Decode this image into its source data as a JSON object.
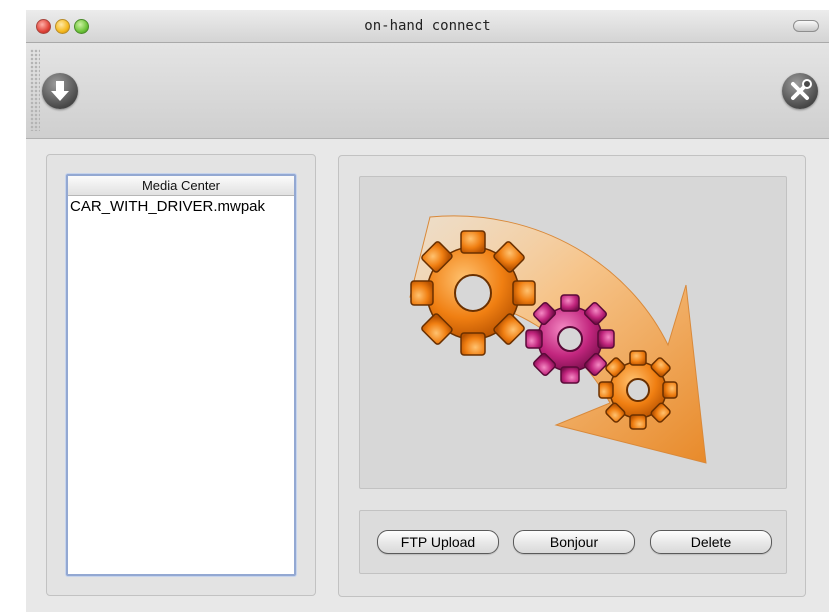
{
  "window": {
    "title": "on-hand connect"
  },
  "toolbar": {
    "download_icon": "download-arrow-icon",
    "tools_icon": "tools-icon"
  },
  "media_list": {
    "header": "Media Center",
    "items": [
      "CAR_WITH_DRIVER.mwpak"
    ]
  },
  "preview": {
    "icon": "gears-arrow-icon"
  },
  "actions": {
    "ftp_upload_label": "FTP Upload",
    "bonjour_label": "Bonjour",
    "delete_label": "Delete"
  },
  "colors": {
    "gear_orange": "#f07f12",
    "gear_magenta": "#c2267e",
    "arrow_orange": "#f5b56a",
    "list_border": "#93a8d2"
  }
}
